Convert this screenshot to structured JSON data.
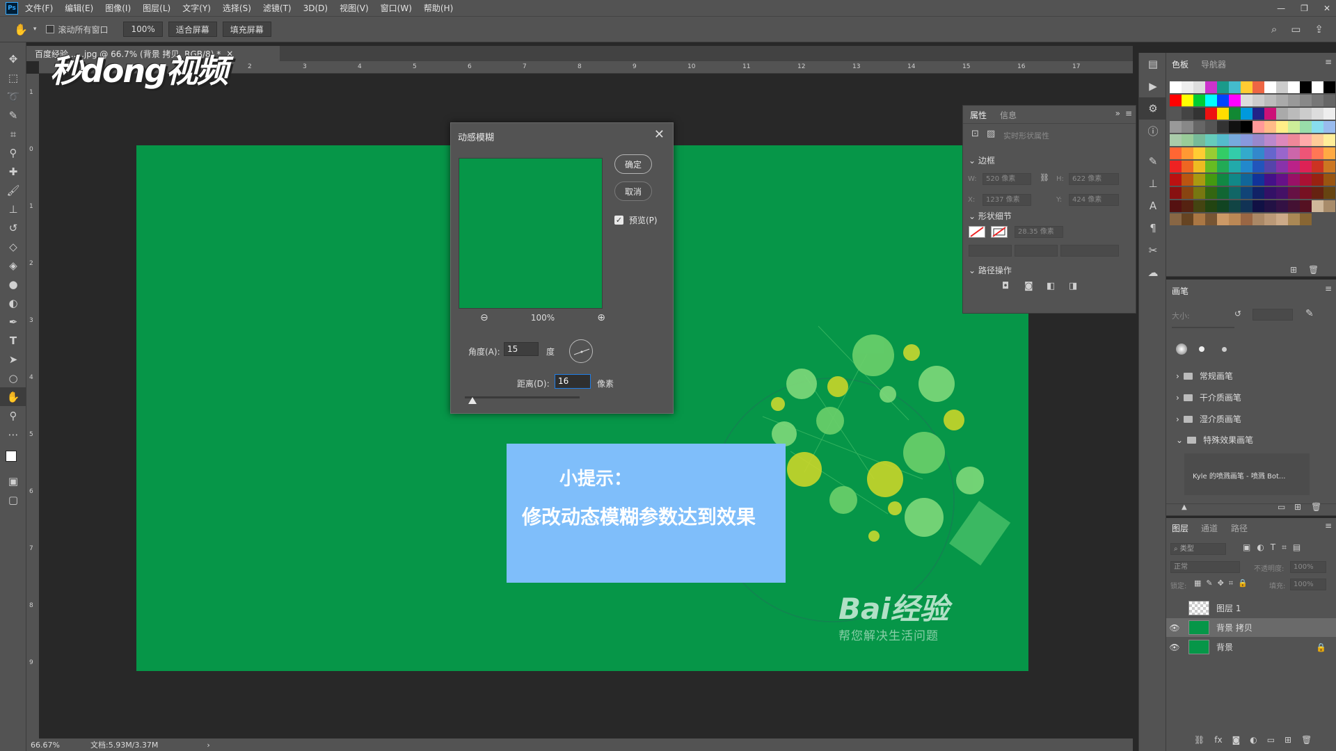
{
  "app": {
    "menu": [
      "文件(F)",
      "编辑(E)",
      "图像(I)",
      "图层(L)",
      "文字(Y)",
      "选择(S)",
      "滤镜(T)",
      "3D(D)",
      "视图(V)",
      "窗口(W)",
      "帮助(H)"
    ]
  },
  "options": {
    "scroll_all": "滚动所有窗口",
    "zoom": "100%",
    "fit_screen": "适合屏幕",
    "fill_screen": "填充屏幕"
  },
  "document": {
    "tab_label": "百度经验 ... .jpg @ 66.7% (背景 拷贝, RGB/8) *",
    "ruler_top": [
      "2",
      "3",
      "4",
      "5",
      "6",
      "7",
      "8",
      "9",
      "10",
      "11",
      "12",
      "13",
      "14",
      "15",
      "16",
      "17"
    ],
    "ruler_left": [
      "1",
      "0",
      "1",
      "2",
      "3",
      "4",
      "5",
      "6",
      "7",
      "8",
      "9"
    ]
  },
  "watermark": {
    "text": "秒dong视频"
  },
  "tip": {
    "title": "小提示：",
    "body": "修改动态模糊参数达到效果"
  },
  "baidu": {
    "logo": "Bai经验",
    "slogan": "帮您解决生活问题"
  },
  "dialog": {
    "title": "动感模糊",
    "ok": "确定",
    "cancel": "取消",
    "preview_label": "预览(P)",
    "preview_checked": true,
    "zoom": "100%",
    "angle_label": "角度(A):",
    "angle_value": "15",
    "angle_unit": "度",
    "distance_label": "距离(D):",
    "distance_value": "16",
    "distance_unit": "像素"
  },
  "properties": {
    "tabs": [
      "属性",
      "信息"
    ],
    "shape_props": "实时形状属性",
    "section_bounds": "边框",
    "w_label": "W:",
    "w_value": "520 像素",
    "h_label": "H:",
    "h_value": "622 像素",
    "x_label": "X:",
    "x_value": "1237 像素",
    "y_label": "Y:",
    "y_value": "424 像素",
    "section_shape": "形状细节",
    "stroke_value": "28.35 像素",
    "section_path": "路径操作"
  },
  "swatches": {
    "tabs": [
      "色板",
      "导航器"
    ],
    "colors": [
      "#ffffff",
      "#eeeeee",
      "#dddddd",
      "#cc33cc",
      "#1a9a8a",
      "#44bbcc",
      "#ffcc33",
      "#ee6644",
      "#ffffff",
      "#cccccc",
      "#ffffff",
      "#000000",
      "#ffffff",
      "#000000",
      "#ff0000",
      "#ffff00",
      "#00cc33",
      "#00ffff",
      "#0044ff",
      "#ff00ff",
      "#dddddd",
      "#cccccc",
      "#bbbbbb",
      "#aaaaaa",
      "#999999",
      "#888888",
      "#777777",
      "#666666",
      "#555555",
      "#444444",
      "#333333",
      "#ee1111",
      "#ffdd00",
      "#118833",
      "#0099dd",
      "#222288",
      "#cc1177",
      "#aaaaaa",
      "#bbbbbb",
      "#cccccc",
      "#dddddd",
      "#eeeeee",
      "#999999",
      "#888888",
      "#666666",
      "#555555",
      "#333333",
      "#111111",
      "#000000",
      "#ff9999",
      "#ffbb88",
      "#ffee88",
      "#ccee99",
      "#99ddaa",
      "#88ddee",
      "#99bbee",
      "#aaccaa",
      "#99cc99",
      "#77bb99",
      "#66ccbb",
      "#55bbcc",
      "#77aadd",
      "#8899dd",
      "#9988cc",
      "#bb88cc",
      "#dd88bb",
      "#ee8899",
      "#ffaaaa",
      "#ffcc99",
      "#ffee99",
      "#ff6633",
      "#ff9933",
      "#ffcc33",
      "#99cc33",
      "#33cc66",
      "#33ccaa",
      "#33aacc",
      "#3388cc",
      "#6666cc",
      "#9966cc",
      "#cc66aa",
      "#ee5577",
      "#ff7755",
      "#ffaa44",
      "#ee2222",
      "#ee6622",
      "#eebb22",
      "#66bb22",
      "#22aa55",
      "#22aaaa",
      "#2288cc",
      "#2255bb",
      "#5544aa",
      "#8833aa",
      "#bb2288",
      "#dd2255",
      "#cc3322",
      "#cc7722",
      "#bb1111",
      "#bb5511",
      "#aa9911",
      "#449911",
      "#118844",
      "#118888",
      "#116699",
      "#113399",
      "#441188",
      "#661188",
      "#991166",
      "#aa1133",
      "#992211",
      "#995511",
      "#881111",
      "#884411",
      "#777711",
      "#336611",
      "#116633",
      "#116666",
      "#114477",
      "#112266",
      "#331166",
      "#441166",
      "#661144",
      "#771122",
      "#662211",
      "#664411",
      "#551111",
      "#552211",
      "#444411",
      "#224411",
      "#114422",
      "#114444",
      "#113355",
      "#111144",
      "#221144",
      "#331144",
      "#441133",
      "#551122",
      "#cfb89a",
      "#a88c6a",
      "#886644",
      "#664422",
      "#aa7744",
      "#775533",
      "#cc9966",
      "#bb8855",
      "#996644",
      "#aa8866",
      "#bb9977",
      "#ccaa88",
      "#aa8855",
      "#886633"
    ]
  },
  "brushes": {
    "tab": "画笔",
    "size_label": "大小:",
    "folders": [
      "常规画笔",
      "干介质画笔",
      "湿介质画笔",
      "特殊效果画笔"
    ],
    "brush_name": "Kyle 的喷溅画笔 - 喷溅 Bot..."
  },
  "layers": {
    "tabs": [
      "图层",
      "通道",
      "路径"
    ],
    "search": "类型",
    "blend": "正常",
    "opacity_label": "不透明度:",
    "opacity_value": "100%",
    "lock_label": "锁定:",
    "fill_label": "填充:",
    "fill_value": "100%",
    "items": [
      {
        "name": "图层 1",
        "visible": false
      },
      {
        "name": "背景 拷贝",
        "visible": true
      },
      {
        "name": "背景",
        "visible": true
      }
    ]
  },
  "status": {
    "zoom": "66.67%",
    "doc": "文档:5.93M/3.37M"
  }
}
